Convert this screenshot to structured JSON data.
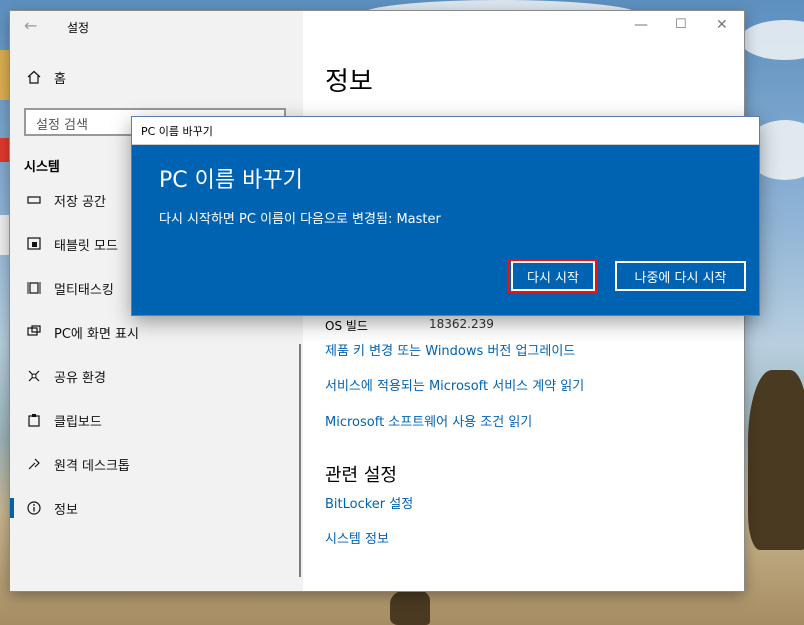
{
  "window": {
    "title": "설정"
  },
  "sidebar": {
    "home_label": "홈",
    "search_placeholder": "설정 검색",
    "section": "시스템",
    "items": [
      {
        "label": "저장 공간",
        "icon": "storage-icon"
      },
      {
        "label": "태블릿 모드",
        "icon": "tablet-icon"
      },
      {
        "label": "멀티태스킹",
        "icon": "multitasking-icon"
      },
      {
        "label": "PC에 화면 표시",
        "icon": "project-icon"
      },
      {
        "label": "공유 환경",
        "icon": "share-icon"
      },
      {
        "label": "클립보드",
        "icon": "clipboard-icon"
      },
      {
        "label": "원격 데스크톱",
        "icon": "remote-desktop-icon"
      },
      {
        "label": "정보",
        "icon": "info-icon",
        "selected": true
      }
    ]
  },
  "content": {
    "title": "정보",
    "os_build_label": "OS 빌드",
    "os_build_value": "18362.239",
    "links": [
      "제품 키 변경 또는 Windows 버전 업그레이드",
      "서비스에 적용되는 Microsoft 서비스 계약 읽기",
      "Microsoft 소프트웨어 사용 조건 읽기"
    ],
    "related_heading": "관련 설정",
    "related_links": [
      "BitLocker 설정",
      "시스템 정보"
    ]
  },
  "dialog": {
    "window_title": "PC 이름 바꾸기",
    "heading": "PC 이름 바꾸기",
    "message": "다시 시작하면 PC 이름이 다음으로 변경됨: Master",
    "restart_label": "다시 시작",
    "later_label": "나중에 다시 시작"
  },
  "colors": {
    "accent": "#0063b1",
    "highlight": "#e11111"
  }
}
